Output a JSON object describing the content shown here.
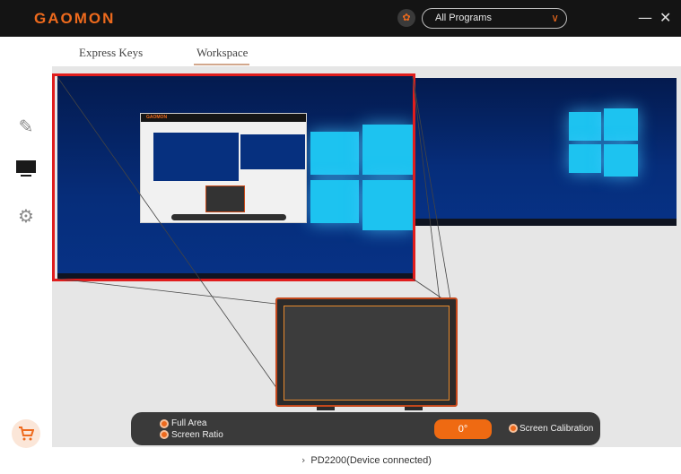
{
  "app": {
    "logo_text": "GAOMON",
    "brand_color": "#ee6a1d"
  },
  "header": {
    "apps_icon": "apps-grid-icon",
    "program_select": {
      "value": "All Programs",
      "icon": "chevron-down-icon"
    },
    "minimize_symbol": "—",
    "close_symbol": "✕"
  },
  "tabs": [
    {
      "label": "Express Keys",
      "active": false
    },
    {
      "label": "Workspace",
      "active": true
    }
  ],
  "sidebar": {
    "items": [
      {
        "icon": "pen-icon",
        "glyph": "✎"
      },
      {
        "icon": "monitor-icon",
        "glyph": "▬"
      },
      {
        "icon": "gear-icon",
        "glyph": "⚙"
      }
    ],
    "shop_icon": {
      "icon": "cart-icon",
      "glyph": "🛒"
    }
  },
  "mapping": {
    "full_area_label": "Full Area",
    "screen_ratio_label": "Screen Ratio",
    "rotation_label": "0°",
    "calibration_label": "Screen Calibration",
    "highlight_color": "#e01d1d"
  },
  "footer": {
    "device_label": "PD2200(Device connected)",
    "arrow": "›"
  }
}
